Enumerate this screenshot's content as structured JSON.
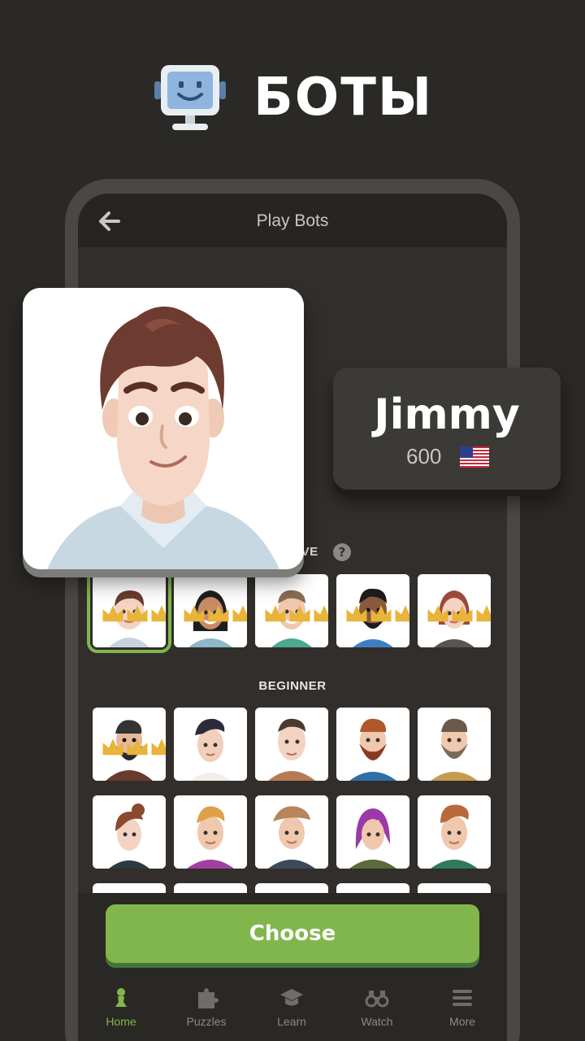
{
  "hero": {
    "title": "БОТЫ",
    "icon": "robot-monitor-icon"
  },
  "appbar": {
    "title": "Play Bots",
    "back_icon": "back-arrow-icon"
  },
  "featured_bot": {
    "name": "Jimmy",
    "rating": "600",
    "country_flag": "us-flag-icon"
  },
  "sections": [
    {
      "label_visible": "IVE",
      "help_icon": "help-icon"
    },
    {
      "label": "BEGINNER"
    }
  ],
  "choose_button": {
    "label": "Choose"
  },
  "nav": {
    "items": [
      {
        "label": "Home",
        "icon": "pawn-icon",
        "active": true
      },
      {
        "label": "Puzzles",
        "icon": "puzzle-icon",
        "active": false
      },
      {
        "label": "Learn",
        "icon": "graduation-cap-icon",
        "active": false
      },
      {
        "label": "Watch",
        "icon": "binoculars-icon",
        "active": false
      },
      {
        "label": "More",
        "icon": "menu-icon",
        "active": false
      }
    ]
  },
  "colors": {
    "accent": "#81b64c",
    "background": "#2b2926",
    "crown": "#e8b43a"
  },
  "help_mark": "?"
}
